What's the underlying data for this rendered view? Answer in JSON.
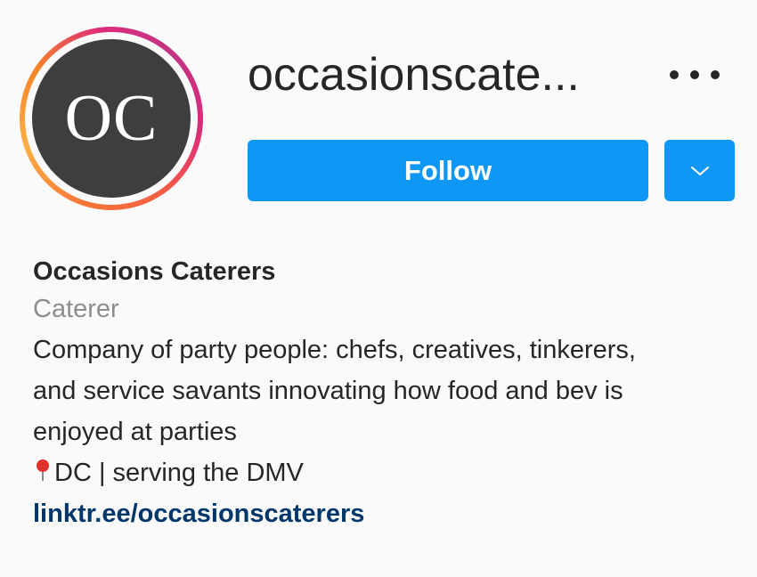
{
  "profile": {
    "avatar_initials": "OC",
    "username": "occasionscate...",
    "follow_label": "Follow",
    "more_icon": "more-horizontal-icon",
    "dropdown_icon": "chevron-down-icon"
  },
  "bio": {
    "full_name": "Occasions Caterers",
    "category": "Caterer",
    "lines": [
      "Company of party people: chefs, creatives, tinkerers,",
      "and service savants innovating how food and bev is",
      "enjoyed at parties"
    ],
    "location_icon": "round-pushpin-icon",
    "location": "DC | serving the DMV",
    "link": "linktr.ee/occasionscaterers"
  },
  "colors": {
    "follow_button": "#0f97f6",
    "link": "#00376b",
    "avatar_bg": "#3e3e3e",
    "category_text": "#8e8e8e"
  }
}
